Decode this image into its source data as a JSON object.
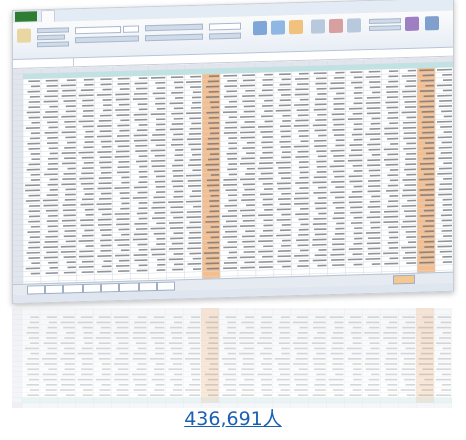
{
  "count_label": "436,691人",
  "colors": {
    "link": "#1a5fb4",
    "highlight_column": "#f2b885",
    "header_row": "#bfe3e3",
    "excel_green": "#2f7d32"
  },
  "icons": [
    "excel-window-icon"
  ]
}
